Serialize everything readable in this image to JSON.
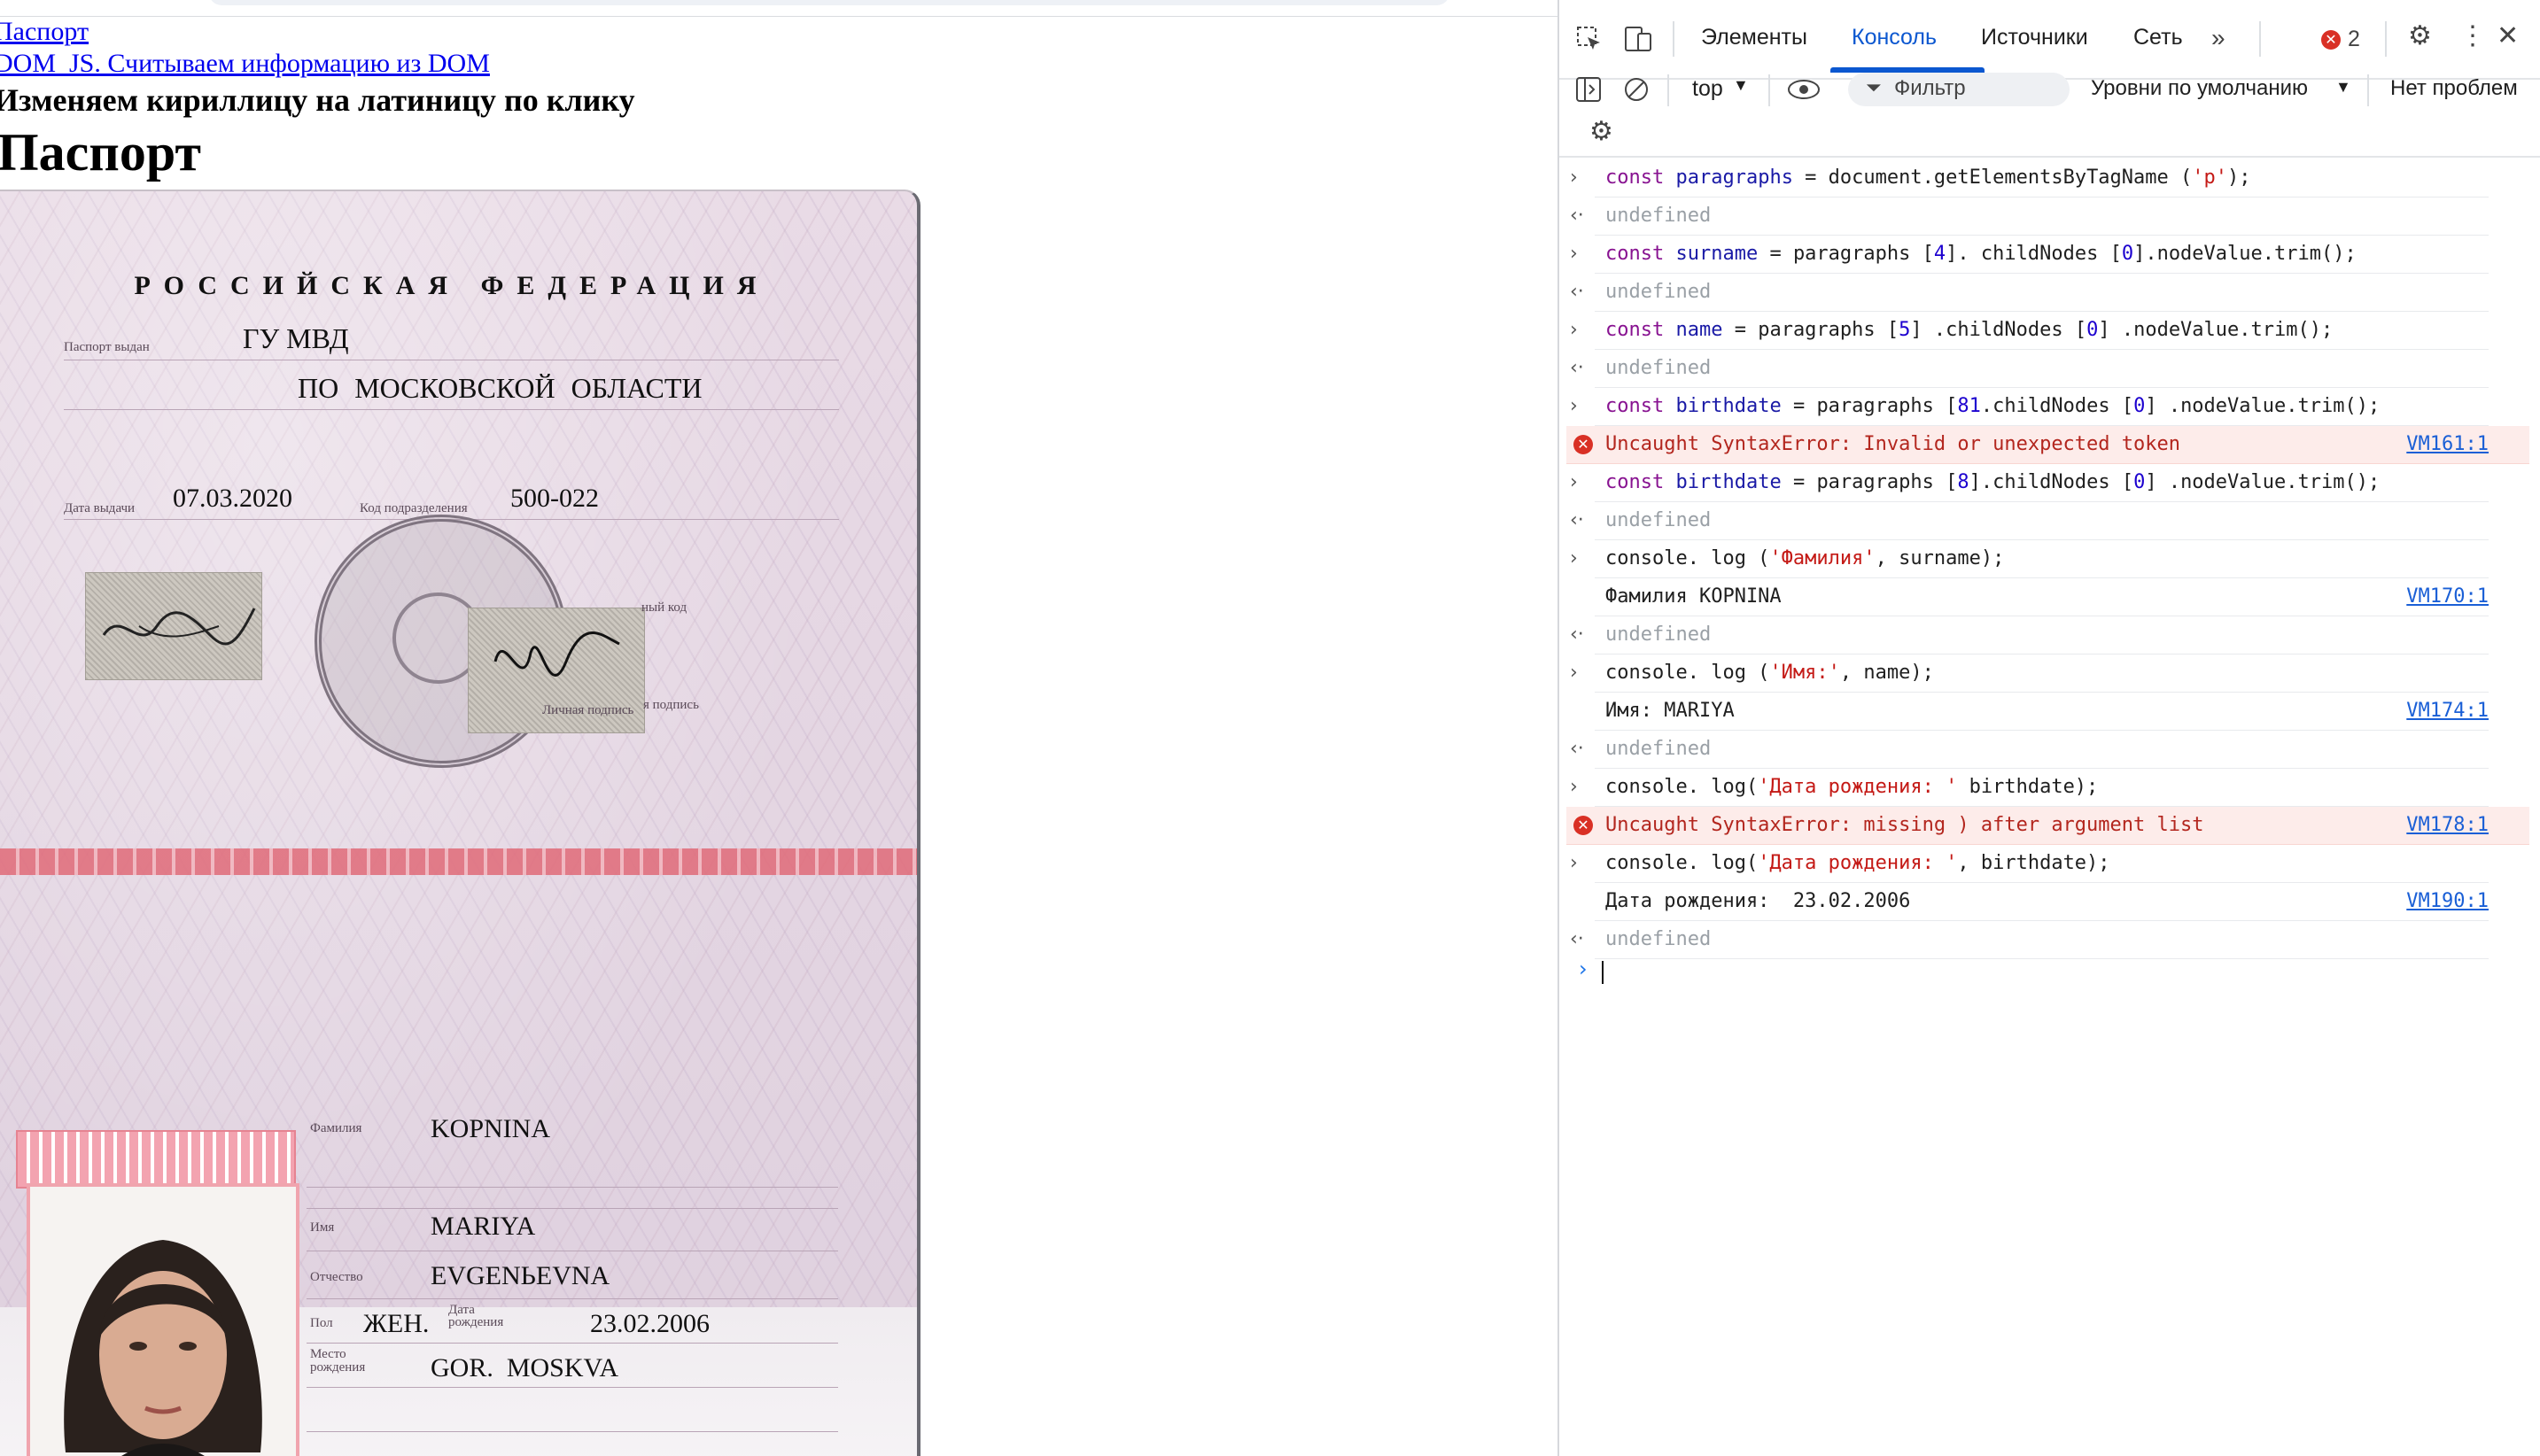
{
  "page": {
    "links": [
      "Паспорт",
      "DOM_JS. Считываем информацию из DOM"
    ],
    "subheading": "Изменяем кириллицу на латиницу по клику",
    "heading": "Паспорт"
  },
  "passport": {
    "header": "РОССИЙСКАЯ ФЕДЕРАЦИЯ",
    "issued_label": "Паспорт выдан",
    "issuer_line1": "ГУ МВД",
    "issuer_line2": "ПО МОСКОВСКОЙ ОБЛАСТИ",
    "issue_date_label": "Дата выдачи",
    "issue_date": "07.03.2020",
    "dept_code_label": "Код подразделения",
    "dept_code": "500-022",
    "dept_code_label2": "ный код",
    "signature_label": "Личная подпись",
    "signature_label2": "я подпись",
    "surname_label": "Фамилия",
    "surname": "KOPNINA",
    "name_label": "Имя",
    "name": "MARIYA",
    "patronymic_label": "Отчество",
    "patronymic": "EVGENЬEVNA",
    "sex_label": "Пол",
    "sex": "ЖЕН.",
    "birth_label": "Дата рождения",
    "birthdate": "23.02.2006",
    "birthplace_label": "Место рождения",
    "birthplace": "GOR.  MOSKVA"
  },
  "devtools": {
    "tabs": [
      "Элементы",
      "Консоль",
      "Источники",
      "Сеть"
    ],
    "active_tab": "Консоль",
    "error_count": "2",
    "context": "top",
    "filter_placeholder": "Фильтр",
    "levels": "Уровни по умолчанию",
    "issues": "Нет проблем",
    "colors": {
      "accent": "#0b57d0",
      "error": "#d93025"
    }
  },
  "console": {
    "rows": [
      {
        "type": "input",
        "text": "const paragraphs = document.getElementsByTagName ('p');"
      },
      {
        "type": "output",
        "text": "undefined"
      },
      {
        "type": "input",
        "text": "const surname = paragraphs [4]. childNodes [0].nodeValue.trim();"
      },
      {
        "type": "output",
        "text": "undefined"
      },
      {
        "type": "input",
        "text": "const name = paragraphs [5] .childNodes [0] .nodeValue.trim();"
      },
      {
        "type": "output",
        "text": "undefined"
      },
      {
        "type": "input",
        "text": "const birthdate = paragraphs [81.childNodes [0] .nodeValue.trim();"
      },
      {
        "type": "error",
        "text": "Uncaught SyntaxError: Invalid or unexpected token",
        "link": "VM161:1"
      },
      {
        "type": "input",
        "text": "const birthdate = paragraphs [8].childNodes [0] .nodeValue.trim();"
      },
      {
        "type": "output",
        "text": "undefined"
      },
      {
        "type": "input",
        "text": "console. log ('Фамилия', surname);"
      },
      {
        "type": "log",
        "text": "Фамилия KOPNINA",
        "link": "VM170:1"
      },
      {
        "type": "output",
        "text": "undefined"
      },
      {
        "type": "input",
        "text": "console. log ('Имя:', name);"
      },
      {
        "type": "log",
        "text": "Имя: MARIYA",
        "link": "VM174:1"
      },
      {
        "type": "output",
        "text": "undefined"
      },
      {
        "type": "input",
        "text": "console. log('Дата рождения: ' birthdate);"
      },
      {
        "type": "error",
        "text": "Uncaught SyntaxError: missing ) after argument list",
        "link": "VM178:1"
      },
      {
        "type": "input",
        "text": "console. log('Дата рождения: ', birthdate);"
      },
      {
        "type": "log",
        "text": "Дата рождения:  23.02.2006",
        "link": "VM190:1"
      },
      {
        "type": "output",
        "text": "undefined"
      }
    ]
  }
}
